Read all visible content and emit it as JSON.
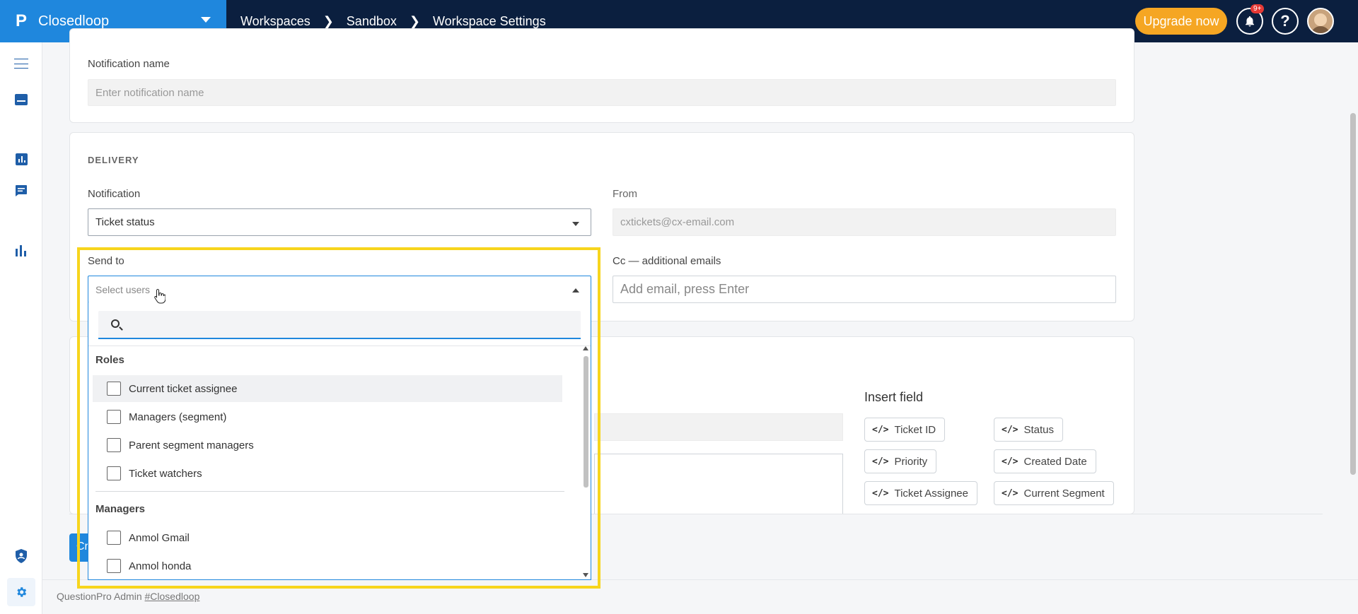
{
  "topbar": {
    "brand_logo": "P",
    "brand_name": "Closedloop",
    "breadcrumbs": [
      "Workspaces",
      "Sandbox",
      "Workspace Settings"
    ],
    "upgrade_label": "Upgrade now",
    "notification_badge": "9+",
    "help_label": "?"
  },
  "sidebar": {
    "icons": [
      "menu-icon",
      "inbox-icon",
      "analytics-icon",
      "chat-icon",
      "bar-chart-icon",
      "shield-icon",
      "gear-icon"
    ]
  },
  "form": {
    "notification_name_label": "Notification name",
    "notification_name_placeholder": "Enter notification name",
    "delivery_label": "DELIVERY",
    "notification_label": "Notification",
    "notification_value": "Ticket status",
    "from_label": "From",
    "from_value": "cxtickets@cx-email.com",
    "send_to_label": "Send to",
    "send_to_placeholder": "Select users",
    "cc_label": "Cc — additional emails",
    "cc_placeholder": "Add email, press Enter"
  },
  "insert_field": {
    "title": "Insert field",
    "code_glyph": "</>",
    "chips": [
      "Ticket ID",
      "Status",
      "Priority",
      "Created Date",
      "Ticket Assignee",
      "Current Segment"
    ]
  },
  "dropdown": {
    "groups": [
      {
        "label": "Roles",
        "items": [
          "Current ticket assignee",
          "Managers (segment)",
          "Parent segment managers",
          "Ticket watchers"
        ]
      },
      {
        "label": "Managers",
        "items": [
          "Anmol Gmail",
          "Anmol honda"
        ]
      }
    ]
  },
  "create_button_label": "Cr",
  "footer": {
    "prefix": "QuestionPro Admin",
    "link": "#Closedloop"
  },
  "colors": {
    "topbar": "#0b1f3f",
    "brand": "#1f87dd",
    "upgrade": "#f5a623",
    "highlight": "#f7d51d"
  }
}
